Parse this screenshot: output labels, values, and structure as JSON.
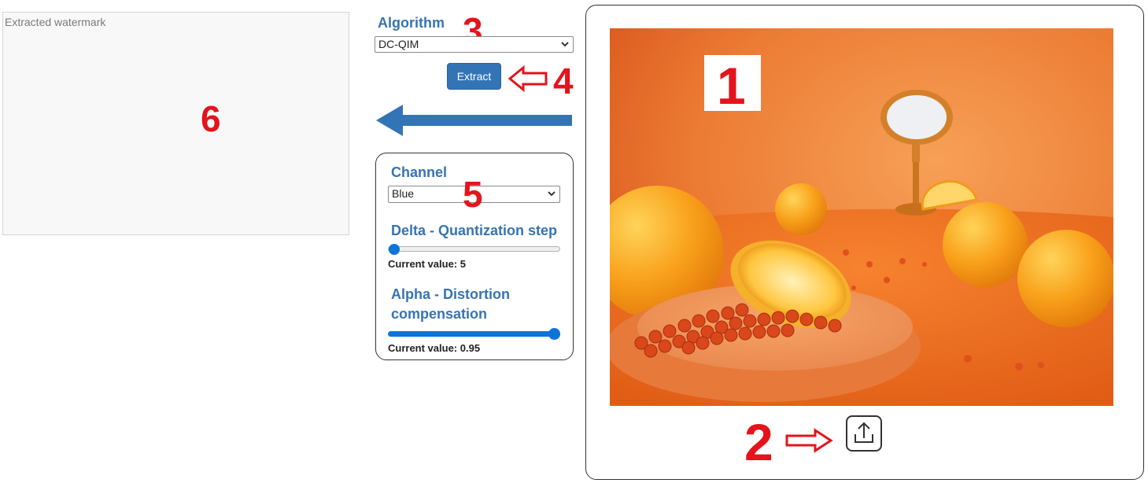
{
  "watermark_panel": {
    "label": "Extracted watermark"
  },
  "algorithm": {
    "label": "Algorithm",
    "selected": "DC-QIM",
    "extract_label": "Extract"
  },
  "settings": {
    "channel": {
      "label": "Channel",
      "selected": "Blue"
    },
    "delta": {
      "label": "Delta - Quantization step",
      "value_text": "Current value: 5",
      "value": 5,
      "fraction": 0.0
    },
    "alpha": {
      "label_line1": "Alpha - Distortion",
      "label_line2": "compensation",
      "value_text": "Current value: 0.95",
      "value": 0.95,
      "fraction": 1.0
    }
  },
  "annotations": {
    "n1": "1",
    "n2": "2",
    "n3": "3",
    "n4": "4",
    "n5": "5",
    "n6": "6"
  },
  "colors": {
    "accent_blue": "#3674b4",
    "button_blue": "#3374b6",
    "annotation_red": "#e3141c",
    "slider_blue": "#0b74d9"
  },
  "icons": {
    "upload": "upload-icon",
    "dropdown": "chevron-down-icon",
    "big_arrow": "arrow-left-icon",
    "outline_arrow": "outline-arrow-icon"
  }
}
